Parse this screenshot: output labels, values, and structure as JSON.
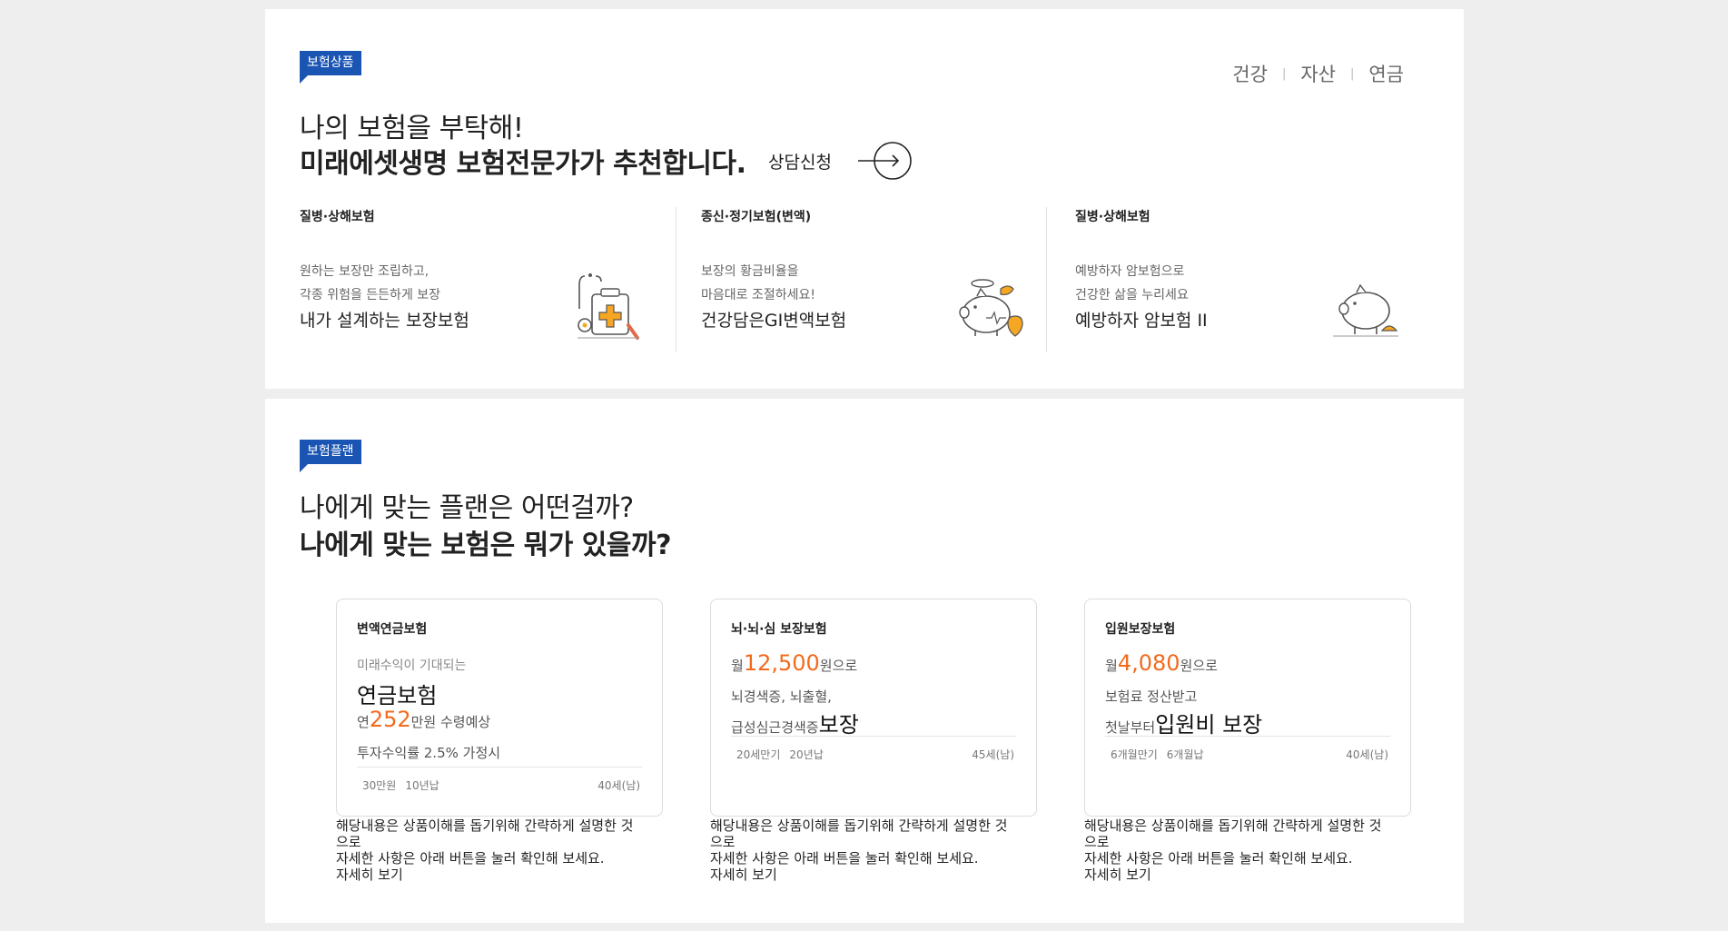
{
  "products_section": {
    "tag": "보험상품",
    "headline_light": "나의 보험을 부탁해!",
    "headline_bold": "미래에셋생명 보험전문가가 추천합니다.",
    "consult_label": "상담신청",
    "tabs": [
      "건강",
      "자산",
      "연금"
    ],
    "products": [
      {
        "category": "질병·상해보험",
        "desc1": "원하는 보장만 조립하고,",
        "desc2": "각종 위험을 든든하게 보장",
        "name": "내가 설계하는 보장보험"
      },
      {
        "category": "종신·정기보험(변액)",
        "desc1": "보장의 황금비율을",
        "desc2": "마음대로 조절하세요!",
        "name": "건강담은GI변액보험"
      },
      {
        "category": "질병·상해보험",
        "desc1": "예방하자 암보험으로",
        "desc2": "건강한 삶을 누리세요",
        "name": "예방하자 암보험 II"
      }
    ]
  },
  "plans_section": {
    "tag": "보험플랜",
    "headline_light": "나에게 맞는 플랜은 어떤걸까?",
    "headline_bold": "나에게 맞는 보험은 뭐가 있을까?",
    "plans": [
      {
        "title": "변액연금보험",
        "sub": "미래수익이 기대되는",
        "big": "연금보험",
        "amount_prefix": "연",
        "amount": "252",
        "amount_suffix": "만원 수령예상",
        "assume": "투자수익률 2.5% 가정시",
        "meta1": "30만원",
        "meta2": "10년납",
        "meta_right": "40세(남)"
      },
      {
        "title": "뇌·뇌·심 보장보험",
        "amount_prefix": "월",
        "amount": "12,500",
        "amount_suffix": "원으로",
        "line2": "뇌경색증, 뇌출혈,",
        "line3_small": "급성심근경색증",
        "line3_big": "보장",
        "meta1": "20세만기",
        "meta2": "20년납",
        "meta_right": "45세(남)"
      },
      {
        "title": "입원보장보험",
        "amount_prefix": "월",
        "amount": "4,080",
        "amount_suffix": "원으로",
        "line2": "보험료 정산받고",
        "line3_small": "첫날부터",
        "line3_big": "입원비 보장",
        "meta1": "6개월만기",
        "meta2": "6개월납",
        "meta_right": "40세(남)"
      }
    ],
    "note_line1": "해당내용은 상품이해를 돕기위해 간략하게 설명한 것으로",
    "note_line2": "자세한 사항은 아래 버튼을 눌러 확인해 보세요.",
    "more_label": "자세히 보기"
  },
  "colors": {
    "tag_blue": "#1a55b4",
    "accent_orange": "#f26b1d",
    "illustration_orange": "#f5a623"
  },
  "icons": [
    "arrow-right-circle-icon",
    "medical-kit-icon",
    "piggy-bank-heart-icon",
    "piggy-bank-icon"
  ]
}
